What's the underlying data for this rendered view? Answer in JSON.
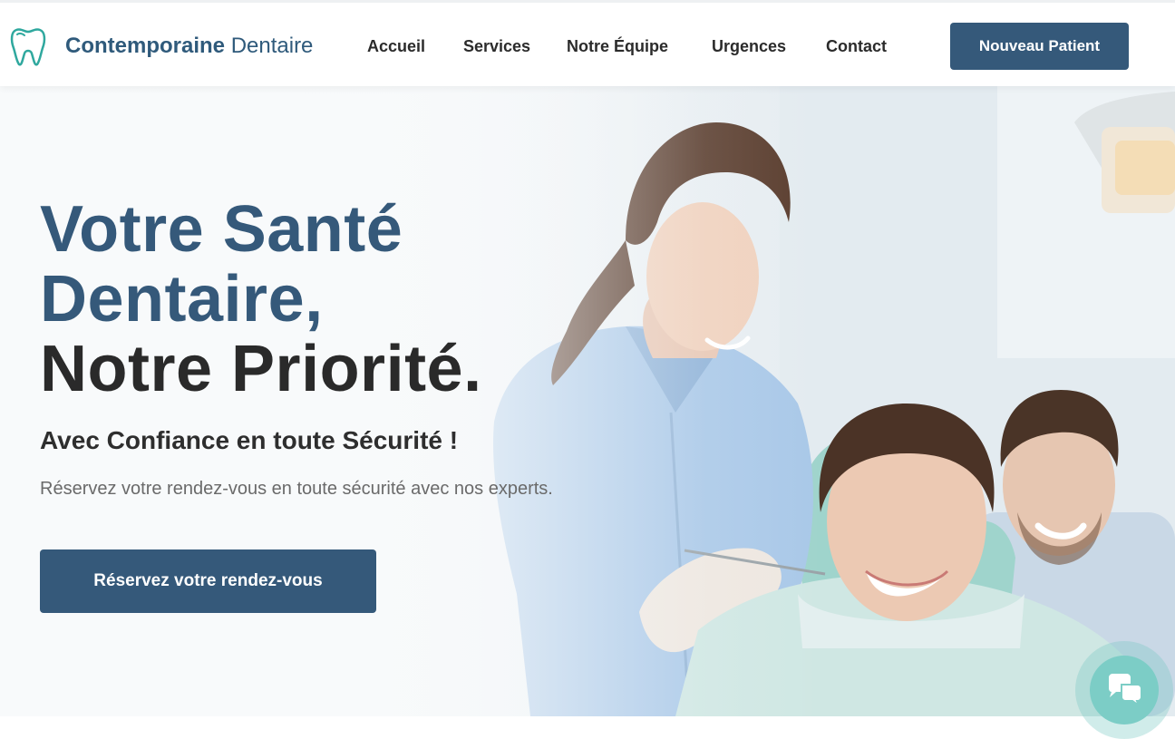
{
  "brand": {
    "name_bold": "Contemporaine",
    "name_light": "Dentaire",
    "logo_icon": "tooth-icon"
  },
  "nav": {
    "items": [
      {
        "label": "Accueil"
      },
      {
        "label": "Services"
      },
      {
        "label": "Notre Équipe"
      },
      {
        "label": "Urgences"
      },
      {
        "label": "Contact"
      }
    ],
    "cta_label": "Nouveau Patient"
  },
  "hero": {
    "title_line1": "Votre Santé",
    "title_line2": "Dentaire,",
    "title_line3": "Notre Priorité.",
    "subtitle": "Avec Confiance en toute Sécurité !",
    "description": "Réservez votre rendez-vous en toute sécurité avec nos experts.",
    "cta_label": "Réservez votre rendez-vous"
  },
  "chat": {
    "icon": "chat-bubbles-icon"
  },
  "colors": {
    "primary": "#35597a",
    "accent_teal": "#2fa89e",
    "chat": "#7ccdc6",
    "text_dark": "#2a2a2a"
  }
}
